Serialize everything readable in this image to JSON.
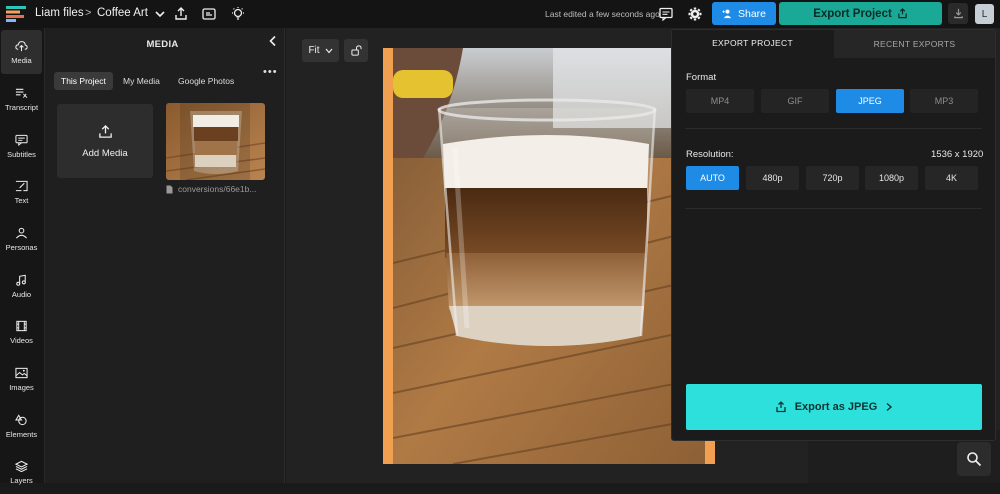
{
  "header": {
    "breadcrumb_parent": "Liam files",
    "breadcrumb_sep": ">",
    "project_name": "Coffee Art",
    "last_edited": "Last edited a few seconds ago",
    "share_label": "Share",
    "export_label": "Export Project",
    "avatar_initial": "L"
  },
  "sidebar": {
    "items": [
      {
        "label": "Media",
        "icon": "upload-cloud-icon"
      },
      {
        "label": "Transcript",
        "icon": "transcript-icon"
      },
      {
        "label": "Subtitles",
        "icon": "subtitles-icon"
      },
      {
        "label": "Text",
        "icon": "text-icon"
      },
      {
        "label": "Personas",
        "icon": "persona-icon"
      },
      {
        "label": "Audio",
        "icon": "music-note-icon"
      },
      {
        "label": "Videos",
        "icon": "film-icon"
      },
      {
        "label": "Images",
        "icon": "image-icon"
      },
      {
        "label": "Elements",
        "icon": "shapes-icon"
      },
      {
        "label": "Layers",
        "icon": "layers-icon"
      }
    ]
  },
  "media_panel": {
    "title": "MEDIA",
    "tabs": [
      "This Project",
      "My Media",
      "Google Photos"
    ],
    "more": "•••",
    "add_media": "Add Media",
    "file_name": "conversions/66e1b..."
  },
  "canvas": {
    "zoom_label": "Fit"
  },
  "export_panel": {
    "tabs": [
      "EXPORT PROJECT",
      "RECENT EXPORTS"
    ],
    "format_label": "Format",
    "formats": [
      "MP4",
      "GIF",
      "JPEG",
      "MP3"
    ],
    "selected_format": "JPEG",
    "resolution_label": "Resolution:",
    "resolution_value": "1536 x 1920",
    "resolutions": [
      "AUTO",
      "480p",
      "720p",
      "1080p",
      "4K"
    ],
    "selected_resolution": "AUTO",
    "export_button": "Export as JPEG"
  },
  "colors": {
    "accent_blue": "#1e8ce6",
    "export_teal": "#1aa997",
    "export_cyan": "#2ee0db",
    "frame_orange": "#f0a050"
  }
}
